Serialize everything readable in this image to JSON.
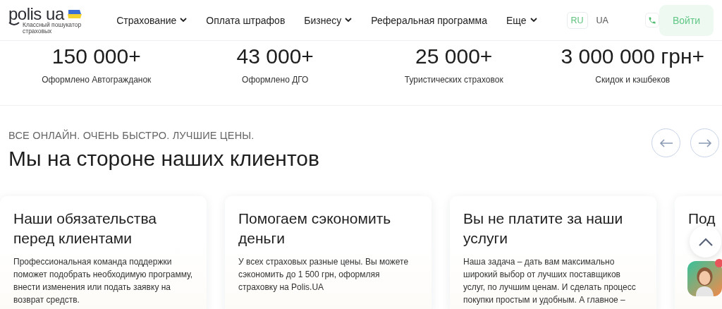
{
  "header": {
    "logo": {
      "name": "polis ua",
      "tagline": "Классный пошукатор страховых"
    },
    "nav": [
      {
        "label": "Страхование",
        "dropdown": true
      },
      {
        "label": "Оплата штрафов",
        "dropdown": false
      },
      {
        "label": "Бизнесу",
        "dropdown": true
      },
      {
        "label": "Реферальная программа",
        "dropdown": false
      },
      {
        "label": "Еще",
        "dropdown": true
      }
    ],
    "languages": [
      {
        "label": "RU",
        "selected": true
      },
      {
        "label": "UA",
        "selected": false
      }
    ],
    "login_button": "Войти"
  },
  "stats": [
    {
      "value": "150 000+",
      "label": "Оформлено Автогражданок"
    },
    {
      "value": "43 000+",
      "label": "Оформлено ДГО"
    },
    {
      "value": "25 000+",
      "label": "Туристических страховок"
    },
    {
      "value": "3 000 000 грн+",
      "label": "Скидок и кэшбеков"
    }
  ],
  "section": {
    "eyebrow": "ВСЕ ОНЛАЙН. ОЧЕНЬ БЫСТРО. ЛУЧШИЕ ЦЕНЫ.",
    "heading": "Мы на стороне наших клиентов"
  },
  "cards": [
    {
      "title": "Наши обязательства перед клиентами",
      "text": "Профессиональная команда поддержки поможет подобрать необходимую программу, внести изменения или подать заявку на возврат средств."
    },
    {
      "title": "Помогаем сэкономить деньги",
      "text": "У всех страховых разные цены. Вы можете сэкономить до 1 500 грн, оформляя страховку на Polis.UA"
    },
    {
      "title": "Вы не платите за наши услуги",
      "text": "Наша задача – дать вам максимально широкий выбор от лучших поставщиков услуг, по лучшим ценам. И сделать процесс покупки простым и удобным. А главное –"
    },
    {
      "title": "Под"
    }
  ],
  "chat": {
    "unread": true
  }
}
